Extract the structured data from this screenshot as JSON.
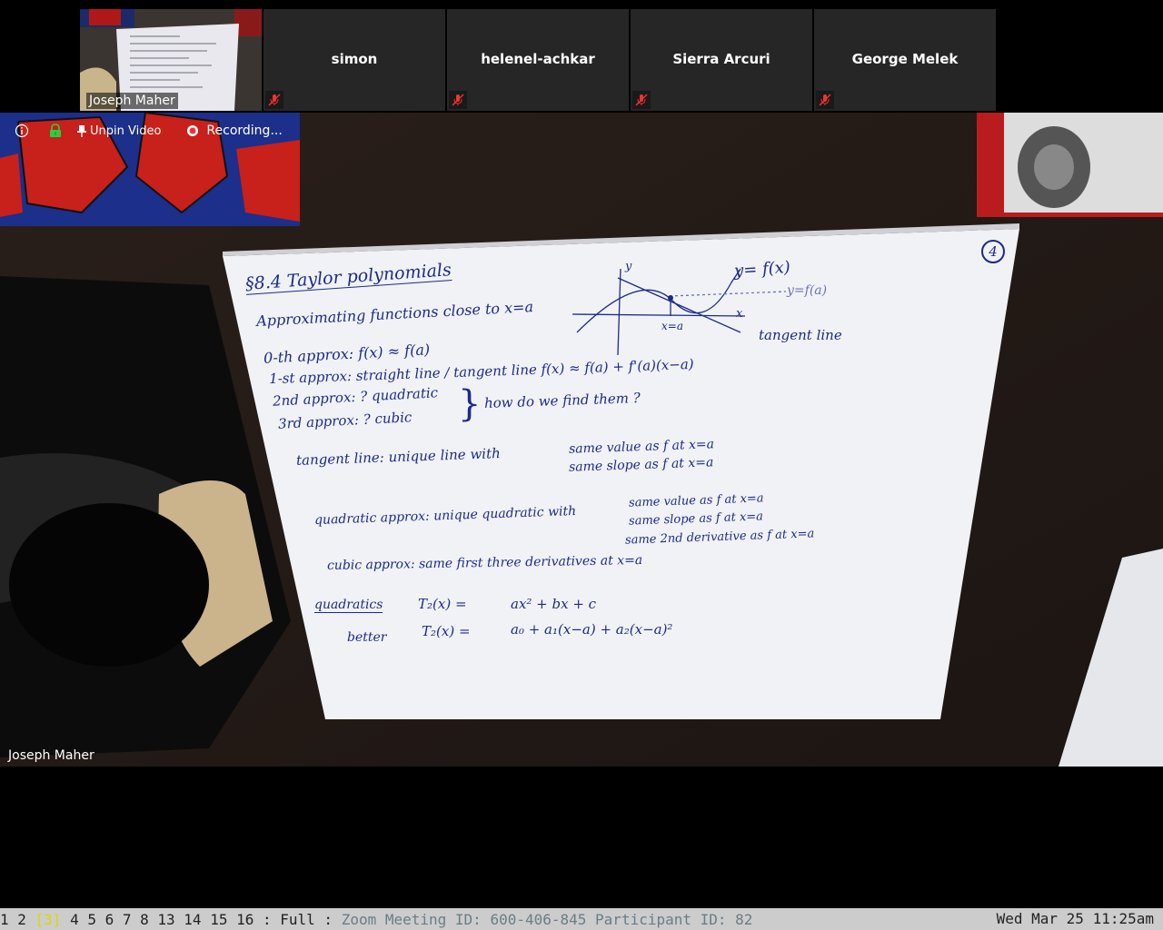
{
  "participants": {
    "video_tile": {
      "name": "Joseph Maher"
    },
    "tiles": [
      {
        "name": "simon"
      },
      {
        "name": "helenel-achkar"
      },
      {
        "name": "Sierra Arcuri"
      },
      {
        "name": "George Melek"
      }
    ]
  },
  "toolbar": {
    "info_icon": "info-icon",
    "lock_icon": "lock-icon",
    "unpin_label": "Unpin Video",
    "recording_label": "Recording..."
  },
  "main_video": {
    "speaker_name": "Joseph Maher",
    "whiteboard": {
      "page_number": "4",
      "heading": "§8.4 Taylor polynomials",
      "line1": "Approximating functions close to x=a",
      "line2": "0-th approx: f(x) ≈ f(a)",
      "line3": "1-st approx: straight line / tangent line   f(x) ≈ f(a) + f'(a)(x−a)",
      "line4": "2nd approx: ? quadratic",
      "line5": "3rd approx: ? cubic",
      "brace_note": "how do we find them ?",
      "graph_y": "y",
      "graph_x": "x",
      "graph_xa": "x=a",
      "graph_curve": "y= f(x)",
      "graph_fa": "y=f(a)",
      "graph_tangent": "tangent line",
      "tangent_def": "tangent line: unique line with",
      "tangent_a": "same value as f at x=a",
      "tangent_b": "same slope as f at x=a",
      "quad_def": "quadratic approx: unique quadratic with",
      "quad_a": "same value as f at x=a",
      "quad_b": "same slope as f at x=a",
      "quad_c": "same 2nd derivative as f at x=a",
      "cubic_def": "cubic approx: same first three derivatives at x=a",
      "quad_label": "quadratics",
      "better_label": "better",
      "t2_lhs": "T₂(x) =",
      "t2_rhs": "ax² + bx + c",
      "t2b_lhs": "T₂(x) =",
      "t2b_rhs": "a₀ + a₁(x−a) + a₂(x−a)²"
    }
  },
  "statusbar": {
    "workspaces_before": "1 2 ",
    "workspace_active": "[3]",
    "workspaces_after": " 4 5 6 7 8 13 14 15 16 : Full : ",
    "window_title": "Zoom Meeting ID: 600-406-845 Participant ID: 82",
    "clock": "Wed Mar 25 11:25am"
  }
}
